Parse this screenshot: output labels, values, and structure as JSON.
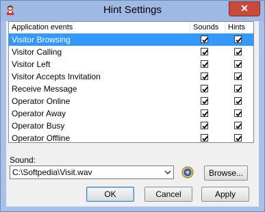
{
  "window": {
    "title": "Hint Settings",
    "close_label": "✕"
  },
  "list": {
    "columns": {
      "events": "Application events",
      "sounds": "Sounds",
      "hints": "Hints"
    },
    "rows": [
      {
        "label": "Visitor Browsing",
        "sounds": true,
        "hints": true,
        "selected": true
      },
      {
        "label": "Visitor Calling",
        "sounds": true,
        "hints": true
      },
      {
        "label": "Visitor Left",
        "sounds": true,
        "hints": true
      },
      {
        "label": "Visitor Accepts Invitation",
        "sounds": true,
        "hints": true
      },
      {
        "label": "Receive Message",
        "sounds": true,
        "hints": true
      },
      {
        "label": "Operator Online",
        "sounds": true,
        "hints": true
      },
      {
        "label": "Operator Away",
        "sounds": true,
        "hints": true
      },
      {
        "label": "Operator Busy",
        "sounds": true,
        "hints": true
      },
      {
        "label": "Operator Offline",
        "sounds": true,
        "hints": true
      }
    ]
  },
  "sound": {
    "label": "Sound:",
    "value": "C:\\Softpedia\\Visit.wav",
    "play_icon": "speaker-icon"
  },
  "buttons": {
    "browse": "Browse...",
    "ok": "OK",
    "cancel": "Cancel",
    "apply": "Apply"
  },
  "colors": {
    "selection": "#3399ff",
    "titlebar": "#9db9e4",
    "close": "#c74a3b"
  }
}
